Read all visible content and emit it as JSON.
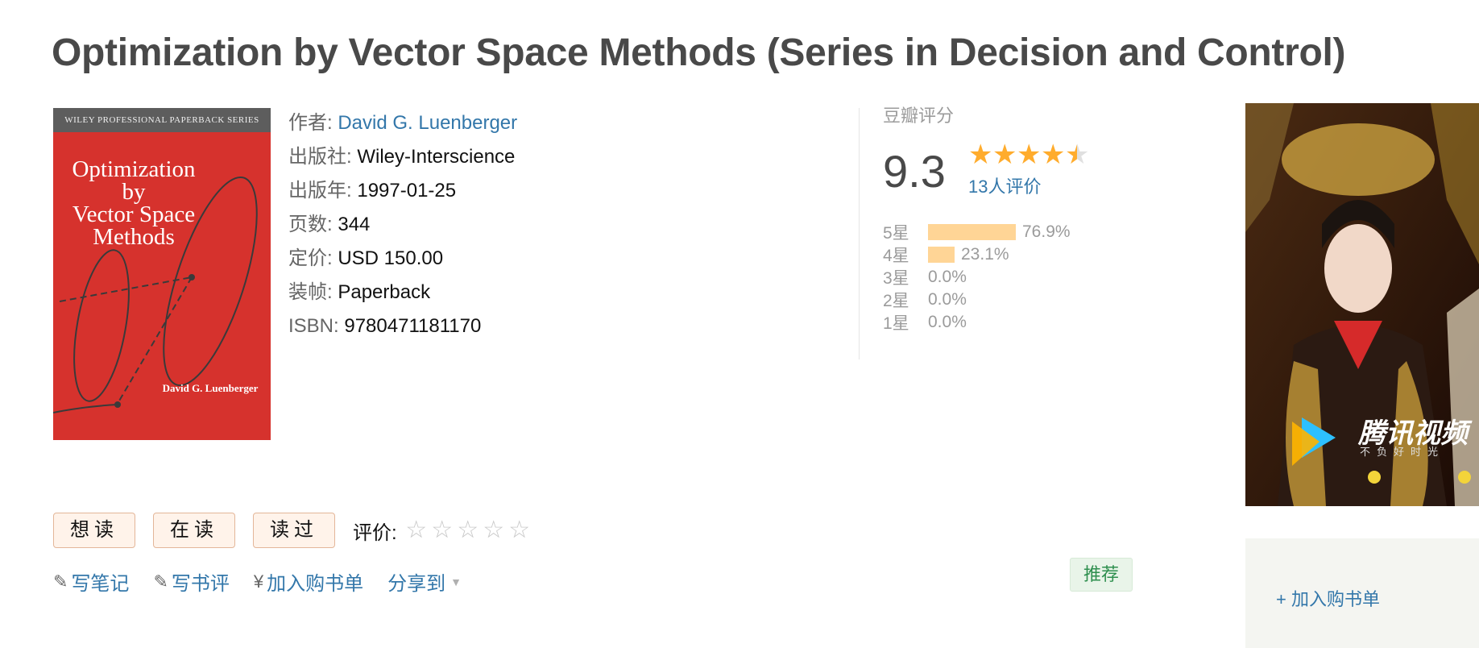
{
  "book": {
    "title": "Optimization by Vector Space Methods (Series in Decision and Control)",
    "cover": {
      "series": "WILEY PROFESSIONAL PAPERBACK SERIES",
      "title_lines": [
        "Optimization",
        "by",
        "Vector Space",
        "Methods"
      ],
      "author": "David G. Luenberger"
    },
    "info": {
      "author_key": "作者:",
      "author": "David G. Luenberger",
      "publisher_key": "出版社:",
      "publisher": "Wiley-Interscience",
      "year_key": "出版年:",
      "year": "1997-01-25",
      "pages_key": "页数:",
      "pages": "344",
      "price_key": "定价:",
      "price": "USD 150.00",
      "binding_key": "装帧:",
      "binding": "Paperback",
      "isbn_key": "ISBN:",
      "isbn": "9780471181170"
    }
  },
  "rating": {
    "label": "豆瓣评分",
    "score": "9.3",
    "stars": 4.5,
    "count": "13人评价",
    "distribution": [
      {
        "label": "5星",
        "percent": "76.9%",
        "value": 76.9
      },
      {
        "label": "4星",
        "percent": "23.1%",
        "value": 23.1
      },
      {
        "label": "3星",
        "percent": "0.0%",
        "value": 0
      },
      {
        "label": "2星",
        "percent": "0.0%",
        "value": 0
      },
      {
        "label": "1星",
        "percent": "0.0%",
        "value": 0
      }
    ]
  },
  "actions": {
    "want": "想读",
    "reading": "在读",
    "read": "读过",
    "eval_label": "评价:"
  },
  "links": {
    "note": "写笔记",
    "review": "写书评",
    "cart": "加入购书单",
    "share": "分享到",
    "currency_symbol": "¥"
  },
  "recommend": "推荐",
  "ad": {
    "brand": "腾讯视频",
    "slogan": "不负好时光"
  },
  "side_panel": {
    "add_cart": "+ 加入购书单"
  },
  "colors": {
    "link": "#3377aa",
    "star": "#ffac2d",
    "bar": "#ffd596",
    "button_bg": "#fff3ea"
  }
}
